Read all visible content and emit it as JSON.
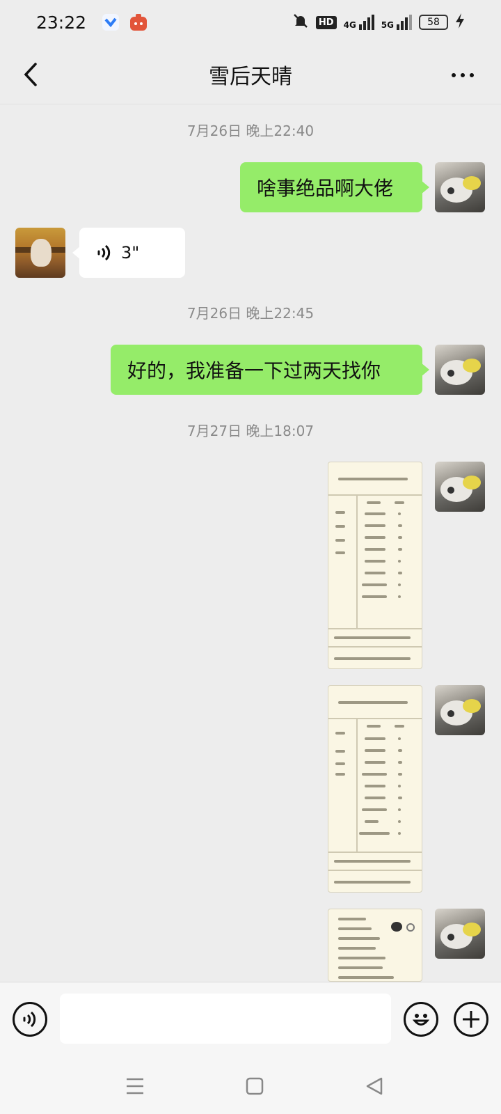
{
  "status_bar": {
    "time": "23:22",
    "hd": "HD",
    "net1": "4G",
    "net2": "5G",
    "battery": "58"
  },
  "header": {
    "title": "雪后天晴"
  },
  "messages": [
    {
      "type": "time",
      "text": "7月26日 晚上22:40"
    },
    {
      "type": "text",
      "side": "self",
      "text": "啥事绝品啊大佬"
    },
    {
      "type": "voice",
      "side": "other",
      "duration": "3\""
    },
    {
      "type": "time",
      "text": "7月26日 晚上22:45"
    },
    {
      "type": "text",
      "side": "self",
      "text": "好的，我准备一下过两天找你"
    },
    {
      "type": "time",
      "text": "7月27日 晚上18:07"
    },
    {
      "type": "image",
      "side": "self"
    },
    {
      "type": "image",
      "side": "self"
    },
    {
      "type": "image",
      "side": "self"
    }
  ],
  "input": {
    "placeholder": ""
  },
  "colors": {
    "self_bubble": "#95ec69",
    "other_bubble": "#ffffff",
    "background": "#ededed"
  },
  "icons": {
    "back": "chevron-left-icon",
    "more": "more-dots-icon",
    "voice": "voice-wave-icon",
    "emoji": "smile-icon",
    "plus": "plus-icon"
  }
}
